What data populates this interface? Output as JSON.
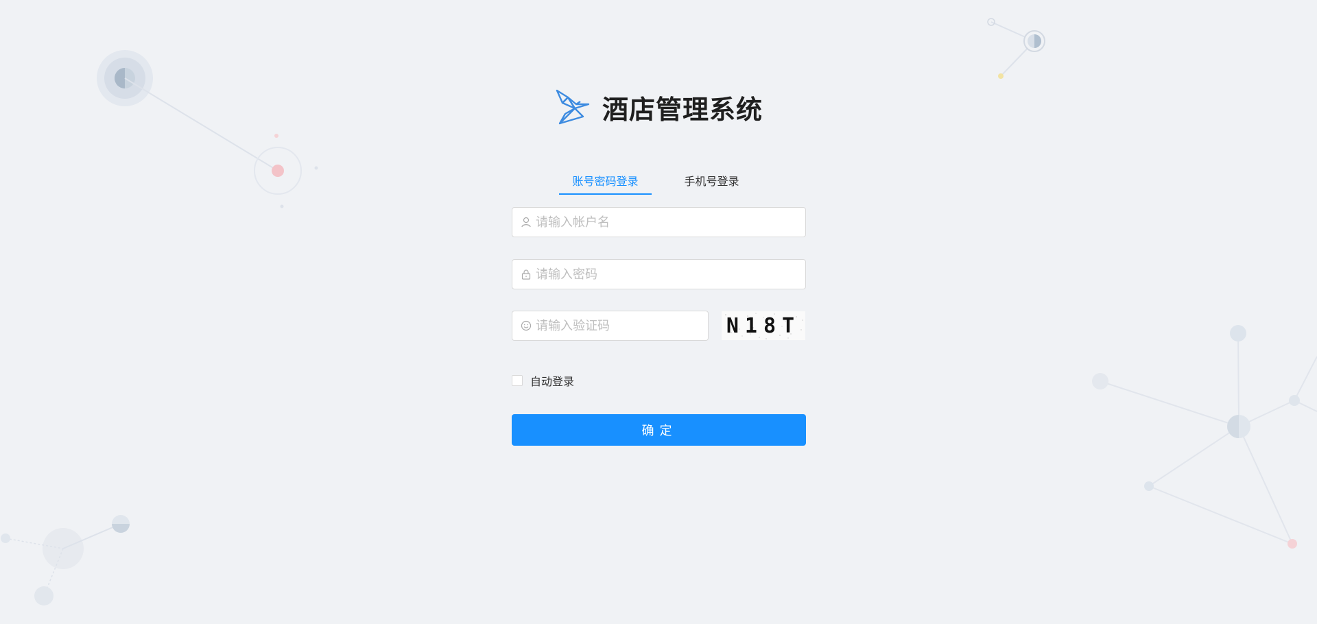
{
  "app": {
    "title": "酒店管理系统",
    "logo_icon": "paper-bird-icon",
    "accent_color": "#1890ff"
  },
  "tabs": [
    {
      "label": "账号密码登录",
      "active": true
    },
    {
      "label": "手机号登录",
      "active": false
    }
  ],
  "form": {
    "username": {
      "placeholder": "请输入帐户名",
      "value": "",
      "icon": "user-icon"
    },
    "password": {
      "placeholder": "请输入密码",
      "value": "",
      "icon": "lock-icon"
    },
    "captcha": {
      "placeholder": "请输入验证码",
      "value": "",
      "icon": "smile-icon"
    },
    "captcha_image_text": "N18T",
    "auto_login": {
      "label": "自动登录",
      "checked": false
    },
    "submit_label": "确定"
  }
}
